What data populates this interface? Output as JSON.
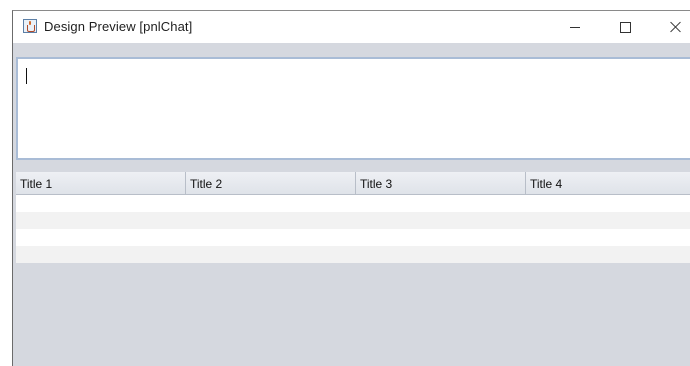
{
  "window": {
    "title": "Design Preview [pnlChat]",
    "icon": "java-icon",
    "controls": [
      "minimize-icon",
      "maximize-icon",
      "close-icon"
    ]
  },
  "chat_input": {
    "value": "",
    "placeholder": ""
  },
  "table": {
    "columns": [
      "Title 1",
      "Title 2",
      "Title 3",
      "Title 4"
    ],
    "rows": [
      [
        "",
        "",
        "",
        ""
      ],
      [
        "",
        "",
        "",
        ""
      ],
      [
        "",
        "",
        "",
        ""
      ],
      [
        "",
        "",
        "",
        ""
      ]
    ]
  },
  "colors": {
    "panel_background": "#d5d8df",
    "input_border": "#a9bcd6",
    "row_even": "#ffffff",
    "row_odd": "#f2f2f2"
  }
}
